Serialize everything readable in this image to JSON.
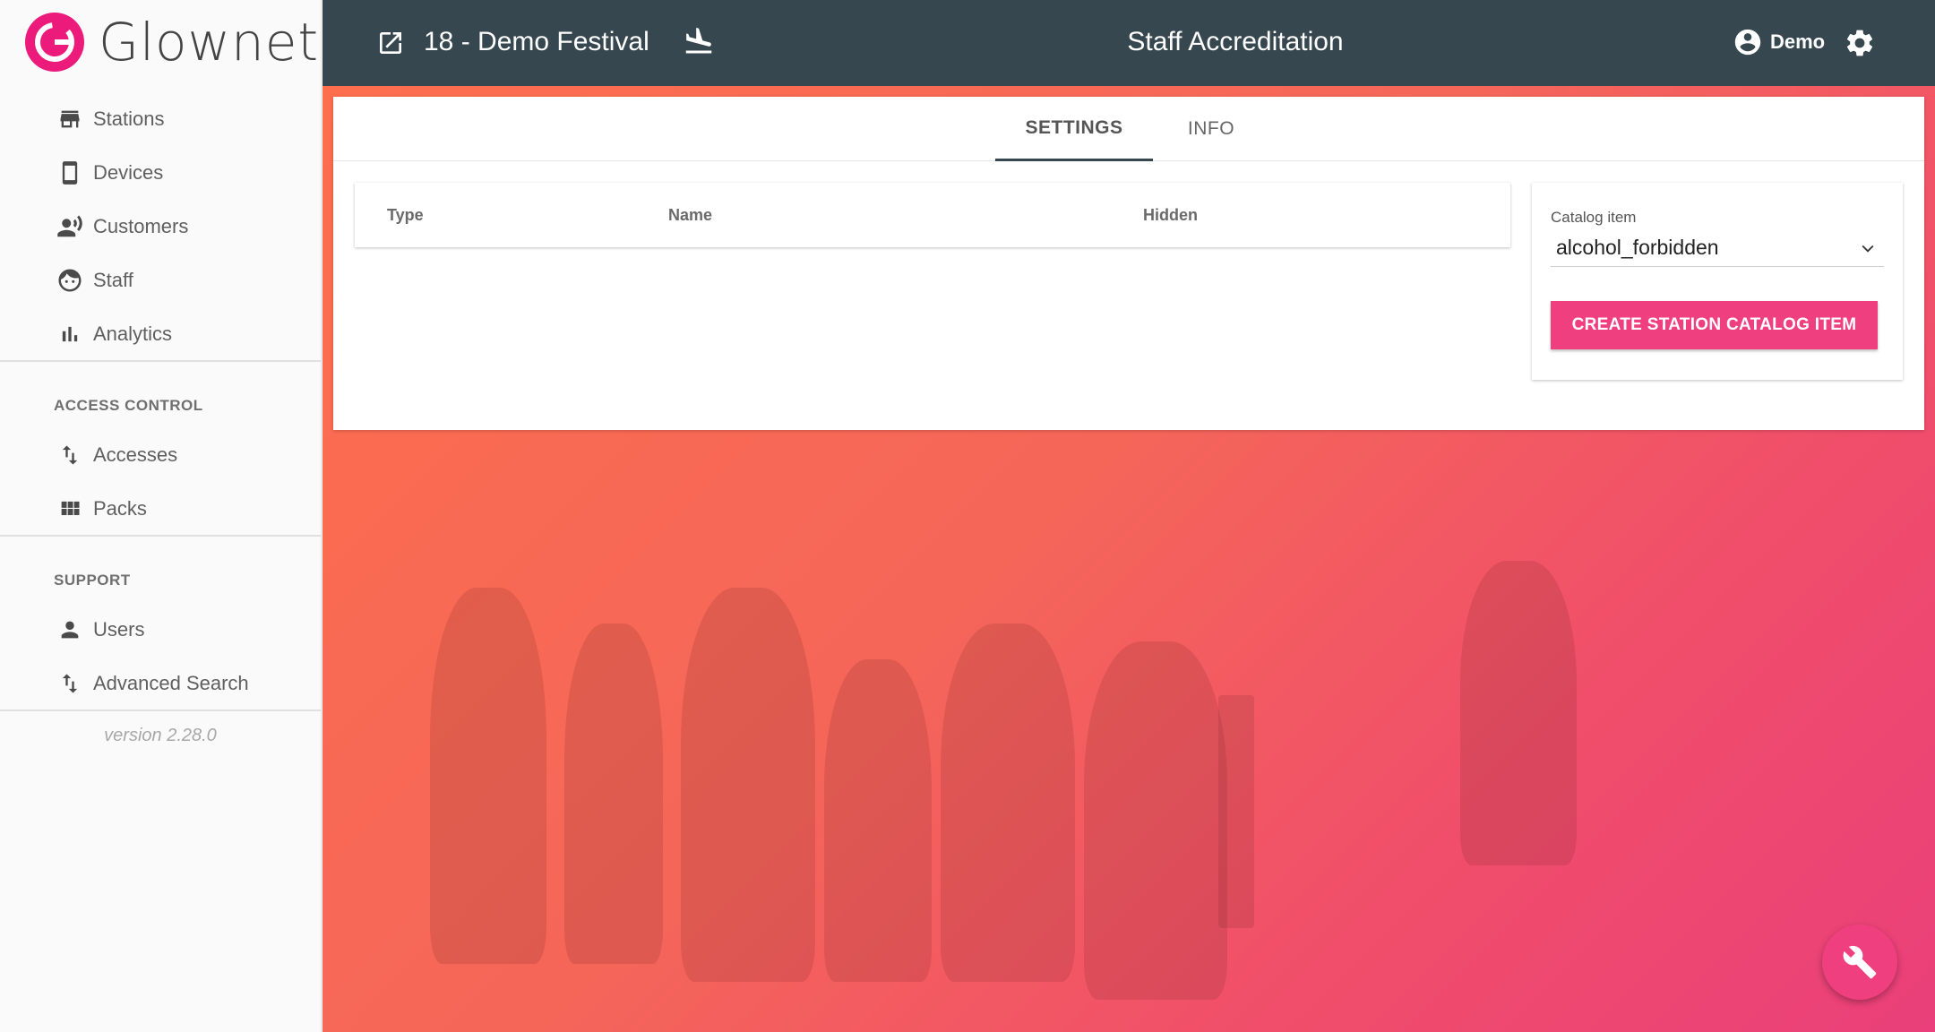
{
  "brand": {
    "name": "Glownet",
    "accent": "#ec1a7b"
  },
  "sidebar": {
    "main_items": [
      {
        "label": "Stations",
        "icon": "store-icon"
      },
      {
        "label": "Devices",
        "icon": "smartphone-icon"
      },
      {
        "label": "Customers",
        "icon": "record-voice-icon"
      },
      {
        "label": "Staff",
        "icon": "face-icon"
      },
      {
        "label": "Analytics",
        "icon": "bar-chart-icon"
      }
    ],
    "access_control": {
      "title": "ACCESS CONTROL",
      "items": [
        {
          "label": "Accesses",
          "icon": "import-export-icon"
        },
        {
          "label": "Packs",
          "icon": "grid-icon"
        }
      ]
    },
    "support": {
      "title": "SUPPORT",
      "items": [
        {
          "label": "Users",
          "icon": "person-icon"
        },
        {
          "label": "Advanced Search",
          "icon": "import-export-icon"
        }
      ]
    },
    "version": "version 2.28.0"
  },
  "topbar": {
    "event_name": "18 - Demo Festival",
    "page_title": "Staff Accreditation",
    "user_name": "Demo",
    "background": "#37474f"
  },
  "tabs": [
    {
      "label": "SETTINGS",
      "active": true
    },
    {
      "label": "INFO",
      "active": false
    }
  ],
  "table": {
    "columns": [
      "Type",
      "Name",
      "Hidden"
    ],
    "rows": []
  },
  "catalog_panel": {
    "label": "Catalog item",
    "selected": "alcohol_forbidden",
    "button_label": "CREATE STATION CATALOG ITEM",
    "button_color": "#f03f7f"
  }
}
